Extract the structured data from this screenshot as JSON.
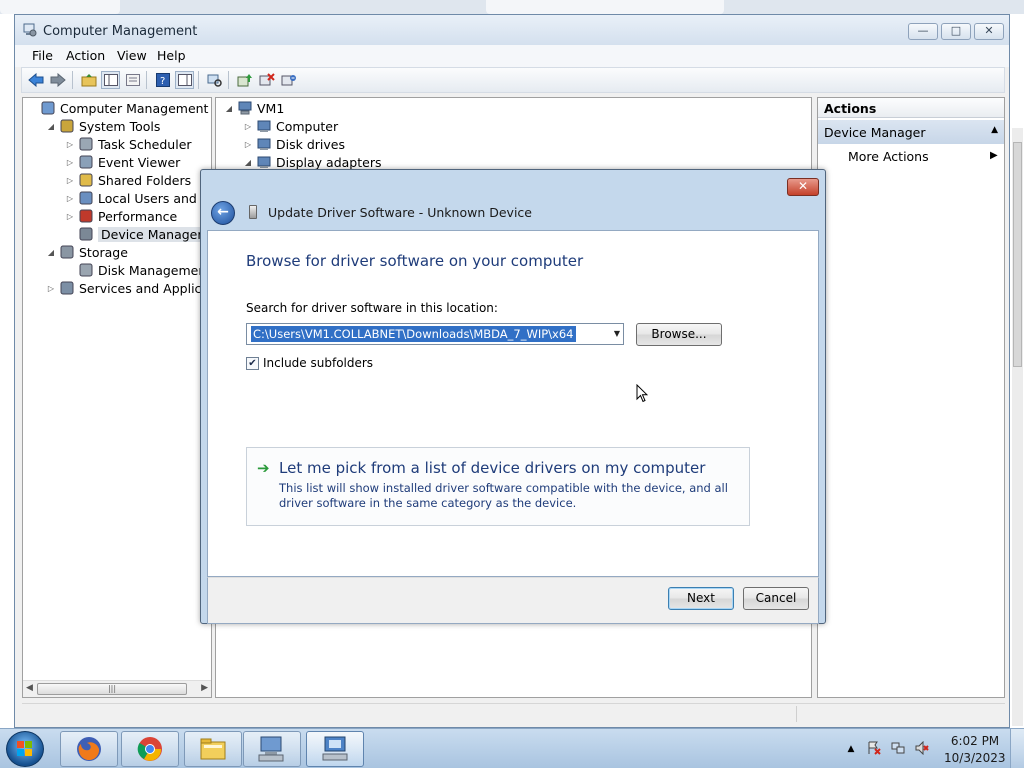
{
  "window": {
    "title": "Computer Management",
    "minimize": "—",
    "maximize": "□",
    "close": "✕"
  },
  "menu": [
    "File",
    "Action",
    "View",
    "Help"
  ],
  "toolbar_icons": [
    "back-arrow-icon",
    "forward-arrow-icon",
    "up-folder-icon",
    "show-hide-tree-icon",
    "properties-icon",
    "help-icon",
    "show-hide-action-pane-icon",
    "scan-hardware-icon",
    "update-driver-icon",
    "uninstall-icon",
    "disable-device-icon"
  ],
  "tree": {
    "items": [
      {
        "label": "Computer Management (Local",
        "icon": "computer-management-icon",
        "expander": "",
        "level": 0
      },
      {
        "label": "System Tools",
        "icon": "system-tools-icon",
        "expander": "◢",
        "level": 1
      },
      {
        "label": "Task Scheduler",
        "icon": "clock-icon",
        "expander": "▷",
        "level": 2
      },
      {
        "label": "Event Viewer",
        "icon": "event-viewer-icon",
        "expander": "▷",
        "level": 2
      },
      {
        "label": "Shared Folders",
        "icon": "shared-folder-icon",
        "expander": "▷",
        "level": 2
      },
      {
        "label": "Local Users and Group",
        "icon": "users-icon",
        "expander": "▷",
        "level": 2
      },
      {
        "label": "Performance",
        "icon": "performance-icon",
        "expander": "▷",
        "level": 2
      },
      {
        "label": "Device Manager",
        "icon": "device-manager-icon",
        "expander": "",
        "level": 2
      },
      {
        "label": "Storage",
        "icon": "storage-icon",
        "expander": "◢",
        "level": 1
      },
      {
        "label": "Disk Management",
        "icon": "disk-management-icon",
        "expander": "",
        "level": 2
      },
      {
        "label": "Services and Applications",
        "icon": "services-icon",
        "expander": "▷",
        "level": 1
      }
    ]
  },
  "devices": {
    "root": "VM1",
    "items": [
      {
        "label": "Computer",
        "expander": "▷",
        "icon": "computer-icon"
      },
      {
        "label": "Disk drives",
        "expander": "▷",
        "icon": "disk-drive-icon"
      },
      {
        "label": "Display adapters",
        "expander": "◢",
        "icon": "display-adapter-icon"
      }
    ]
  },
  "actions": {
    "header": "Actions",
    "section": "Device Manager",
    "more": "More Actions"
  },
  "dialog": {
    "title": "Update Driver Software - Unknown Device",
    "close": "✕",
    "heading": "Browse for driver software on your computer",
    "search_label": "Search for driver software in this location:",
    "path": "C:\\Users\\VM1.COLLABNET\\Downloads\\MBDA_7_WIP\\x64",
    "browse": "Browse...",
    "include_subfolders": "Include subfolders",
    "include_subfolders_checked": true,
    "pick_title": "Let me pick from a list of device drivers on my computer",
    "pick_desc": "This list will show installed driver software compatible with the device, and all driver software in the same category as the device.",
    "next": "Next",
    "cancel": "Cancel"
  },
  "taskbar": {
    "apps": [
      "firefox-icon",
      "chrome-icon",
      "file-explorer-icon",
      "computer-management-icon",
      "remote-desktop-icon"
    ],
    "time": "6:02 PM",
    "date": "10/3/2023"
  }
}
